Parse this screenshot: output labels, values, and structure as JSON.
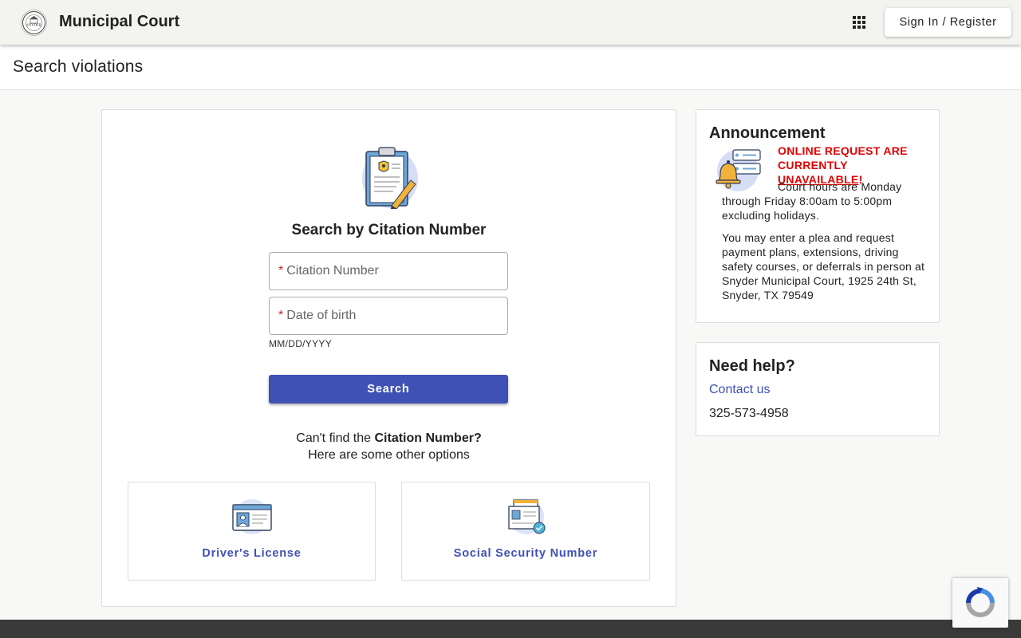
{
  "header": {
    "app_title": "Municipal Court",
    "logo_text": "SNYDER",
    "apps_icon": "apps-grid-icon",
    "signin_label": "Sign In / Register"
  },
  "page": {
    "title": "Search violations"
  },
  "search": {
    "heading": "Search by Citation Number",
    "citation_placeholder": "Citation Number",
    "dob_placeholder": "Date of birth",
    "dob_hint": "MM/DD/YYYY",
    "required_mark": "*",
    "button_label": "Search",
    "cant_find_prefix": "Can't find the ",
    "cant_find_bold": "Citation Number?",
    "cant_find_line2": "Here are some other options",
    "options": [
      {
        "label": "Driver's License",
        "icon": "drivers-license-icon"
      },
      {
        "label": "Social Security Number",
        "icon": "ssn-card-icon"
      }
    ]
  },
  "announcement": {
    "title": "Announcement",
    "alert_prefix": "ONLINE REQUEST ARE CURRENTLY ",
    "alert_emphasis": "UNAVAILABLE",
    "alert_suffix": "!",
    "hours": "Court hours are Monday through Friday 8:00am to 5:00pm excluding holidays.",
    "plea": "You may enter a plea and request payment plans, extensions, driving safety courses, or deferrals in person at Snyder Municipal Court, 1925 24th St, Snyder, TX 79549"
  },
  "help": {
    "title": "Need help?",
    "contact_label": "Contact us",
    "phone": "325-573-4958"
  },
  "colors": {
    "primary": "#3f51b5",
    "alert": "#e30000",
    "footer": "#3a3a3a"
  }
}
